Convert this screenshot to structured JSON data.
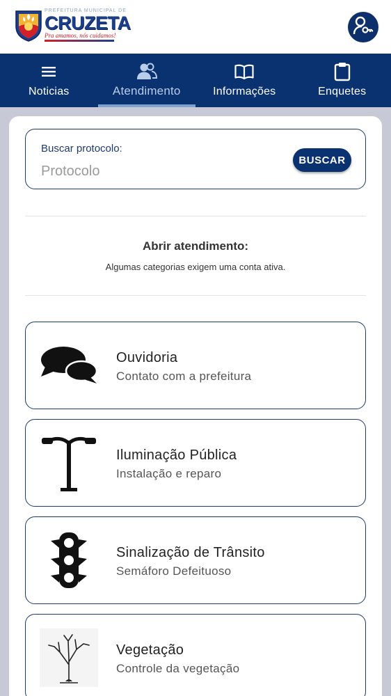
{
  "header": {
    "logo_kicker": "PREFEITURA MUNICIPAL DE",
    "logo_name": "CRUZETA",
    "logo_slogan": "Pra amamos, nós cuidamos!",
    "user_icon": "user-key-icon"
  },
  "nav": {
    "items": [
      {
        "label": "Noticias",
        "icon": "list-icon"
      },
      {
        "label": "Atendimento",
        "icon": "people-icon",
        "active": true
      },
      {
        "label": "Informações",
        "icon": "book-icon"
      },
      {
        "label": "Enquetes",
        "icon": "clipboard-icon"
      }
    ]
  },
  "search": {
    "label": "Buscar protocolo:",
    "placeholder": "Protocolo",
    "button": "BUSCAR"
  },
  "section": {
    "title": "Abrir atendimento:",
    "subtitle": "Algumas categorias exigem uma conta ativa."
  },
  "categories": [
    {
      "title": "Ouvidoria",
      "subtitle": "Contato com a prefeitura",
      "icon": "speech-bubbles-icon"
    },
    {
      "title": "Iluminação Pública",
      "subtitle": "Instalação e reparo",
      "icon": "street-lamp-icon"
    },
    {
      "title": "Sinalização de Trânsito",
      "subtitle": "Semáforo Defeituoso",
      "icon": "traffic-light-icon"
    },
    {
      "title": "Vegetação",
      "subtitle": "Controle da vegetação",
      "icon": "tree-icon"
    }
  ],
  "colors": {
    "primary": "#0a3170",
    "background": "#c7c9d6",
    "accent_red": "#d21f2a"
  }
}
